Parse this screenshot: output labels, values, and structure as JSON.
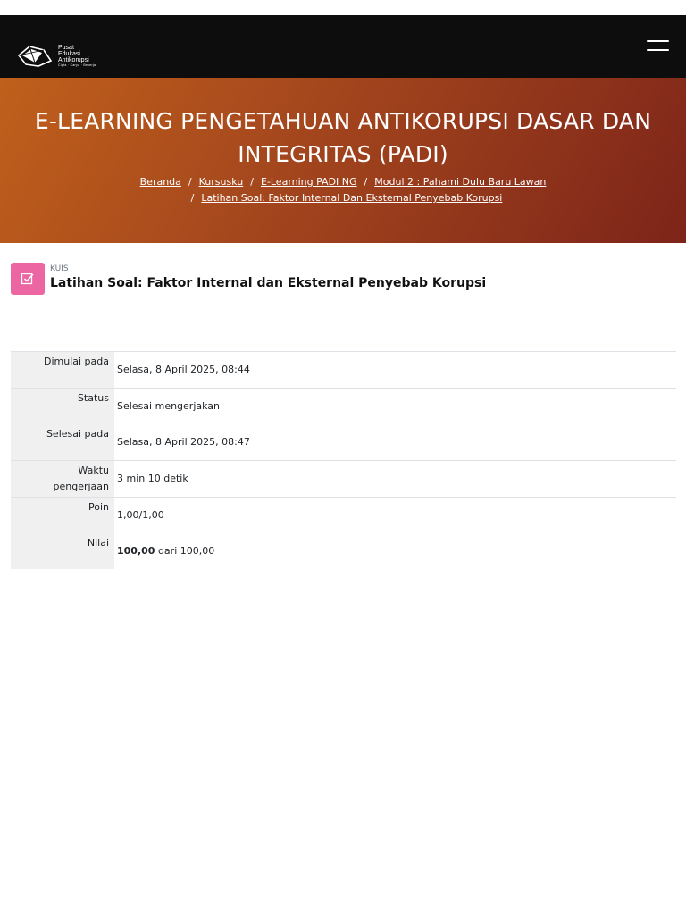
{
  "header": {
    "logo": {
      "line1": "Pusat",
      "line2": "Edukasi",
      "line3": "Antikorupsi",
      "tagline": "Cipta · Karya · Bekerja"
    },
    "menu_icon": "hamburger-icon"
  },
  "hero": {
    "title_line1": "E-LEARNING PENGETAHUAN ANTIKORUPSI DASAR DAN",
    "title_line2": "INTEGRITAS (PADI)",
    "breadcrumb": {
      "separator": "/",
      "items": [
        "Beranda",
        "Kursusku",
        "E-Learning PADI NG",
        "Modul 2 : Pahami Dulu Baru Lawan",
        "Latihan Soal: Faktor Internal Dan Eksternal Penyebab Korupsi"
      ]
    }
  },
  "activity": {
    "icon": "quiz-icon",
    "kind": "KUIS",
    "name": "Latihan Soal: Faktor Internal dan Eksternal Penyebab Korupsi"
  },
  "summary": {
    "rows": [
      {
        "label": "Dimulai pada",
        "value": "Selasa, 8 April 2025, 08:44"
      },
      {
        "label": "Status",
        "value": "Selesai mengerjakan"
      },
      {
        "label": "Selesai pada",
        "value": "Selasa, 8 April 2025, 08:47"
      },
      {
        "label_line1": "Waktu",
        "label_line2": "pengerjaan",
        "value": "3 min 10 detik"
      },
      {
        "label": "Poin",
        "value": "1,00/1,00"
      },
      {
        "label": "Nilai",
        "value_bold": "100,00",
        "value_rest": "dari 100,00"
      }
    ]
  },
  "colors": {
    "topbar": "#0d0d0d",
    "hero_start": "#c0601c",
    "hero_end": "#7e2419",
    "quiz_icon_bg": "#eb66a2",
    "label_bg": "#f0f0f0"
  }
}
